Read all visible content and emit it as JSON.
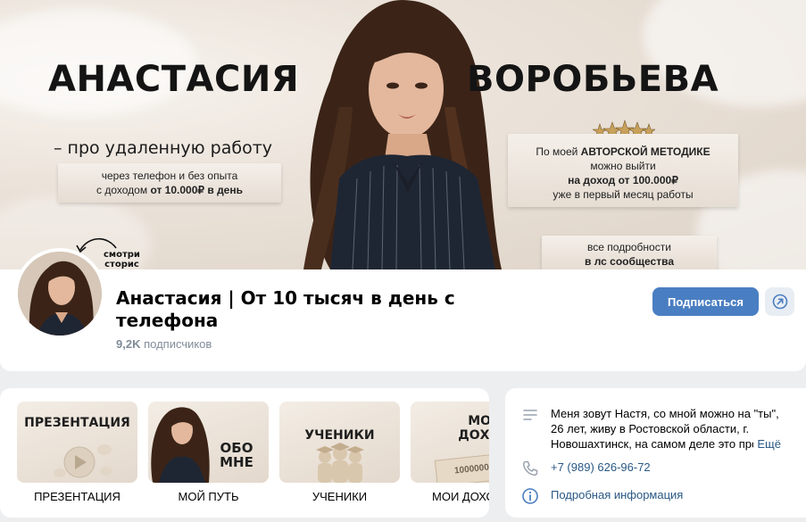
{
  "cover": {
    "name_first": "АНАСТАСИЯ",
    "name_last": "ВОРОБЬЕВА",
    "tagline": "– про удаленную работу",
    "box_left_line1": "через телефон и без опыта",
    "box_left_line2_pre": "с доходом ",
    "box_left_line2_bold": "от 10.000₽ в день",
    "box_right_line1_pre": "По моей ",
    "box_right_line1_bold": "АВТОРСКОЙ МЕТОДИКЕ",
    "box_right_line2": "можно выйти",
    "box_right_line3_bold": "на доход от 100.000₽",
    "box_right_line4": "уже в первый месяц работы",
    "box_bottom_line1": "все подробности",
    "box_bottom_line2_bold": "в лс сообщества",
    "story_note_line1": "смотри",
    "story_note_line2": "сторис"
  },
  "group": {
    "name": "Анастасия | От 10 тысяч в день с телефона",
    "subscribers_count": "9,2K",
    "subscribers_label": " подписчиков",
    "subscribe_label": "Подписаться",
    "share_icon": "share-arrow-icon",
    "accent_color": "#4a7ec2"
  },
  "menu": {
    "items": [
      {
        "thumb_title": "ПРЕЗЕНТАЦИЯ",
        "label": "ПРЕЗЕНТАЦИЯ"
      },
      {
        "thumb_title_line1": "ОБО",
        "thumb_title_line2": "МНЕ",
        "label": "МОЙ ПУТЬ"
      },
      {
        "thumb_title": "УЧЕНИКИ",
        "label": "УЧЕНИКИ"
      },
      {
        "thumb_title_line1": "МОИ",
        "thumb_title_line2": "ДОХОД",
        "thumb_amount": "1000000",
        "label": "МОИ ДОХО"
      }
    ]
  },
  "info": {
    "about": "Меня зовут Настя, со мной можно на \"ты\", 26 лет, живу в Ростовской области, г. Новошахтинск, на самом деле это просто",
    "more_label": "Ещё",
    "phone": "+7 (989) 626-96-72",
    "details_label": "Подробная информация",
    "link_color": "#2a5885"
  }
}
